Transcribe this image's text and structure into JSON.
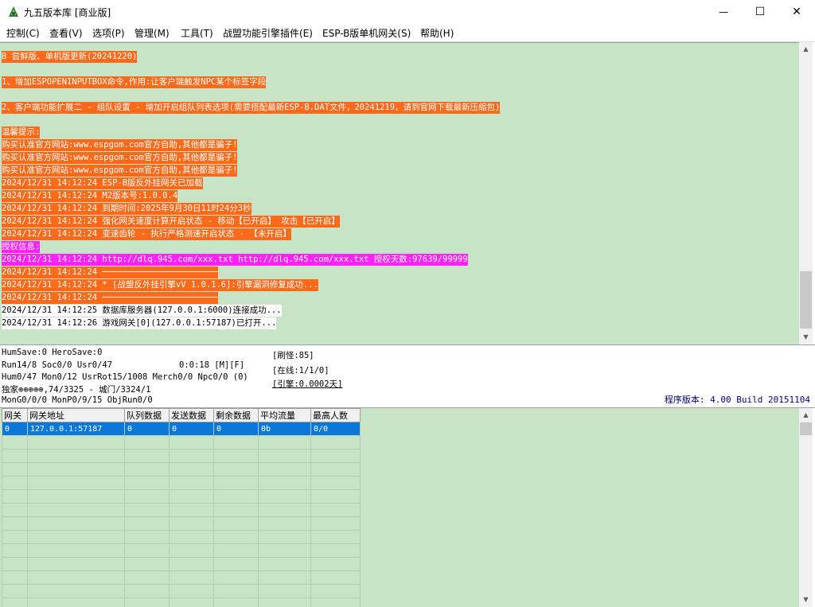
{
  "window": {
    "title": "九五版本库 [商业版]",
    "minimize_glyph": "—",
    "maximize_glyph": "☐",
    "close_glyph": "✕"
  },
  "menu": [
    "控制(C)",
    "查看(V)",
    "选项(P)",
    "管理(M)",
    "工具(T)",
    "战盟功能引擎插件(E)",
    "ESP-B版单机网关(S)",
    "帮助(H)"
  ],
  "log_lines": [
    {
      "text": "B 尝鲜版、单机版更新(20241220)",
      "style": "orange"
    },
    {
      "text": "1、增加ESPOPENINPUTBOX命令,作用:让客户端触发NPC某个标签字段",
      "style": "orange"
    },
    {
      "text": "2、客户端功能扩展二 - 组队设置 - 增加开启组队列表选项(需要搭配最新ESP-B.DAT文件，20241219，请到官网下载最新压缩包)",
      "style": "orange"
    },
    {
      "text": "温馨提示:",
      "style": "orange"
    },
    {
      "text": "购买认准官方网站:www.espgom.com官方自助,其他都是骗子!",
      "style": "orange"
    },
    {
      "text": "购买认准官方网站:www.espgom.com官方自助,其他都是骗子!",
      "style": "orange"
    },
    {
      "text": "购买认准官方网站:www.espgom.com官方自助,其他都是骗子!",
      "style": "orange"
    },
    {
      "text": "2024/12/31 14:12:24 ESP-B版反外挂网关已加载",
      "style": "orange"
    },
    {
      "text": "2024/12/31 14:12:24 M2版本号:1.0.0.4",
      "style": "orange"
    },
    {
      "text": "2024/12/31 14:12:24 到期时间:2025年9月30日11时24分3秒",
      "style": "orange"
    },
    {
      "text": "2024/12/31 14:12:24 强化网关速度计算开启状态 - 移动【已开启】 攻击【已开启】",
      "style": "orange"
    },
    {
      "text": "2024/12/31 14:12:24 变速齿轮 - 执行严格测速开启状态 - 【未开启】",
      "style": "orange"
    },
    {
      "text": "授权信息:",
      "style": "magenta"
    },
    {
      "text": "2024/12/31 14:12:24 http://dlq.945.com/xxx.txt http://dlq.945.com/xxx.txt 授权天数:97639/99999",
      "style": "magenta"
    },
    {
      "text": "2024/12/31 14:12:24 ───────────────────────",
      "style": "orange"
    },
    {
      "text": "2024/12/31 14:12:24 * [战盟反外挂引擎vV 1.0.1.6]:引擎漏洞修复成功...",
      "style": "orange"
    },
    {
      "text": "2024/12/31 14:12:24 ───────────────────────",
      "style": "orange"
    },
    {
      "text": "2024/12/31 14:12:25 数据库服务器(127.0.0.1:6000)连接成功...",
      "style": "plain"
    },
    {
      "text": "2024/12/31 14:12:26 游戏网关[0](127.0.0.1:57187)已打开...",
      "style": "plain"
    }
  ],
  "status": {
    "line1": "HumSave:0 HeroSave:0",
    "line2_left": "Run14/8 Soc0/0 Usr0/47",
    "line2_right": "0:0:18 [M][F]",
    "line3": "Hum0/47 Mon0/12 UsrRot15/1008 Merch0/0 Npc0/0 (0)",
    "line4": "独家⊕⊕⊕⊕⊕,74/3325 - 城门/3324/1",
    "line5": "MonG0/0/0 MonP0/9/15 ObjRun0/0",
    "monster_refresh": "[刷怪:85]",
    "online": "[在线:1/1/0]",
    "engine": "[引擎:0.0002天]",
    "version": "程序版本: 4.00 Build 20151104"
  },
  "grid": {
    "headers": [
      "网关",
      "网关地址",
      "队列数据",
      "发送数据",
      "剩余数据",
      "平均流量",
      "最高人数"
    ],
    "rows": [
      [
        "0",
        "127.0.0.1:57187",
        "0",
        "0",
        "0",
        "0b",
        "0/0"
      ]
    ]
  },
  "colors": {
    "log_background": "#c7e4c7",
    "highlight_orange": "#ff6a1a",
    "highlight_magenta": "#ff22ff",
    "selected_row": "#0a78d7",
    "version_text": "#000080"
  }
}
